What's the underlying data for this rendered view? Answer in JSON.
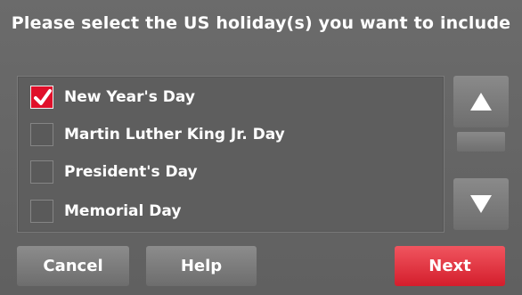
{
  "title": "Please select the US holiday(s) you want to include",
  "holidays": [
    {
      "label": "New Year's Day",
      "checked": true
    },
    {
      "label": "Martin Luther King Jr. Day",
      "checked": false
    },
    {
      "label": "President's Day",
      "checked": false
    },
    {
      "label": "Memorial Day",
      "checked": false
    }
  ],
  "scroll": {
    "up_icon": "triangle-up-icon",
    "down_icon": "triangle-down-icon"
  },
  "buttons": {
    "cancel": "Cancel",
    "help": "Help",
    "next": "Next"
  },
  "colors": {
    "accent": "#e0102a",
    "next_button": "#e23040",
    "background": "#666666"
  }
}
